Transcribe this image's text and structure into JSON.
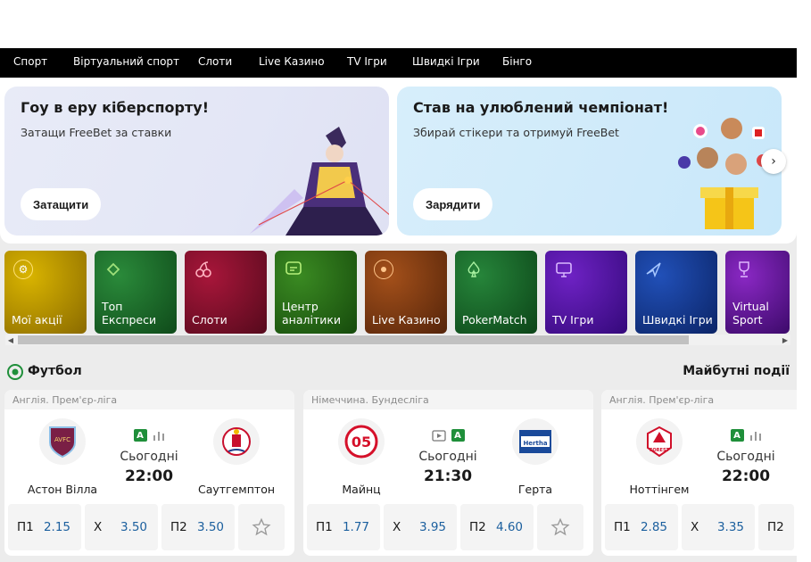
{
  "nav": {
    "items": [
      "Спорт",
      "Віртуальний спорт",
      "Слоти",
      "Live Казино",
      "TV Ігри",
      "Швидкі Ігри",
      "Бінго"
    ]
  },
  "banners": [
    {
      "title": "Гоу в еру кіберспорту!",
      "subtitle": "Затащи FreeBet за ставки",
      "button": "Затащити"
    },
    {
      "title": "Став на улюблений чемпіонат!",
      "subtitle": "Збирай стікери та отримуй FreeBet",
      "button": "Зарядити"
    }
  ],
  "carousel_next_icon": "chevron-right-icon",
  "tiles": [
    {
      "label": "Мої акції",
      "color": "#c9a100",
      "icon": "gear-badge-icon"
    },
    {
      "label": "Топ Експреси",
      "color": "#1e7a2e",
      "icon": "ticket-icon"
    },
    {
      "label": "Слоти",
      "color": "#8c0e2c",
      "icon": "cherry-icon"
    },
    {
      "label": "Центр аналітики",
      "color": "#2f7a1c",
      "icon": "chat-icon"
    },
    {
      "label": "Live Казино",
      "color": "#8a3d0e",
      "icon": "chip-icon"
    },
    {
      "label": "PokerMatch",
      "color": "#1b6b2a",
      "icon": "spade-icon"
    },
    {
      "label": "TV Ігри",
      "color": "#5a16a6",
      "icon": "tv-icon"
    },
    {
      "label": "Швидкі Ігри",
      "color": "#173f9a",
      "icon": "plane-icon"
    },
    {
      "label": "Virtual Sport",
      "color": "#6d1aa6",
      "icon": "trophy-icon"
    }
  ],
  "section": {
    "title": "Футбол",
    "right_label": "Майбутні події",
    "icon": "football-icon"
  },
  "matches": [
    {
      "league": "Англія. Прем'єр-ліга",
      "home": "Астон Вілла",
      "away": "Саутгемптон",
      "day": "Сьогодні",
      "time": "22:00",
      "odds": [
        {
          "label": "П1",
          "value": "2.15"
        },
        {
          "label": "Х",
          "value": "3.50"
        },
        {
          "label": "П2",
          "value": "3.50"
        }
      ]
    },
    {
      "league": "Німеччина. Бундесліга",
      "home": "Майнц",
      "away": "Герта",
      "day": "Сьогодні",
      "time": "21:30",
      "odds": [
        {
          "label": "П1",
          "value": "1.77"
        },
        {
          "label": "Х",
          "value": "3.95"
        },
        {
          "label": "П2",
          "value": "4.60"
        }
      ]
    },
    {
      "league": "Англія. Прем'єр-ліга",
      "home": "Ноттінгем",
      "away": "",
      "day": "Сьогодні",
      "time": "22:00",
      "odds": [
        {
          "label": "П1",
          "value": "2.85"
        },
        {
          "label": "Х",
          "value": "3.35"
        },
        {
          "label": "П2",
          "value": ""
        }
      ]
    }
  ],
  "colors": {
    "nav_bg": "#000000",
    "odds_value": "#1b5f9e",
    "live_badge": "#1f8f3a",
    "page_bg": "#ececec"
  }
}
